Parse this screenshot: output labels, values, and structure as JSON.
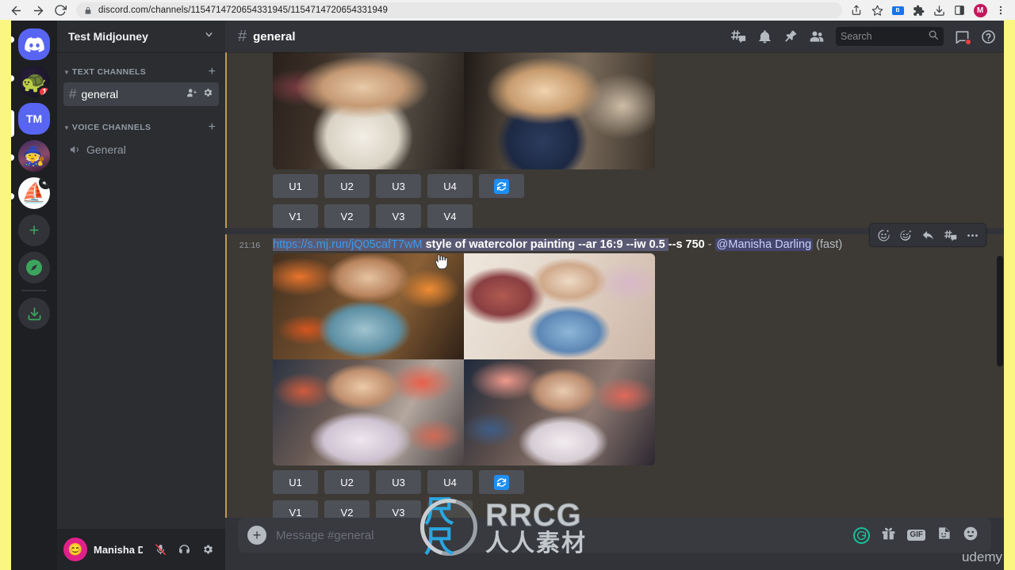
{
  "browser": {
    "url": "discord.com/channels/1154714720654331945/1154714720654331949",
    "back_label": "Back",
    "forward_label": "Forward",
    "reload_label": "Reload",
    "lock_icon": "lock-icon",
    "share_icon": "share-icon",
    "bookmark_icon": "star-icon",
    "extension_blue_label": "B",
    "puzzle_icon": "extensions-icon",
    "download_icon": "download-icon",
    "sidepanel_icon": "side-panel-icon",
    "profile_initial": "M",
    "menu_icon": "three-dot-menu-icon"
  },
  "server_rail": {
    "items": [
      {
        "name": "discord-home",
        "label": "",
        "type": "discord"
      },
      {
        "name": "server-turtle",
        "label": "",
        "type": "turtle",
        "badge": "1"
      },
      {
        "name": "server-test-midjouney",
        "label": "TM",
        "type": "tm",
        "active": true
      },
      {
        "name": "server-wizard",
        "label": "",
        "type": "wizard"
      },
      {
        "name": "server-sailboat",
        "label": "",
        "type": "boat",
        "muted": true
      }
    ],
    "add_server_label": "+",
    "explore_label": "explore-icon",
    "download_apps_label": "download-icon"
  },
  "sidebar": {
    "guild_name": "Test Midjouney",
    "guild_chevron": "chevron-down-icon",
    "categories": [
      {
        "label": "Text Channels",
        "add_label": "+",
        "channels": [
          {
            "name": "general",
            "hash": "#",
            "active": true,
            "icons": [
              "invite-icon",
              "settings-icon"
            ]
          }
        ]
      },
      {
        "label": "Voice Channels",
        "add_label": "+",
        "channels": [
          {
            "name": "General",
            "hash": "speaker-icon",
            "active": false,
            "icons": []
          }
        ]
      }
    ]
  },
  "user_panel": {
    "username": "Manisha D...",
    "mic_icon": "mic-muted-icon",
    "headset_icon": "headset-icon",
    "settings_icon": "gear-icon"
  },
  "chat_header": {
    "hash": "#",
    "channel": "general",
    "icons": [
      "threads-icon",
      "bell-icon",
      "pin-icon",
      "members-icon"
    ],
    "search_placeholder": "Search",
    "search_value": "",
    "inbox_icon": "inbox-icon",
    "help_icon": "help-icon"
  },
  "messages": {
    "top_message": {
      "buttons_row1": [
        "U1",
        "U2",
        "U3",
        "U4"
      ],
      "reroll_label": "reroll-icon",
      "buttons_row2": [
        "V1",
        "V2",
        "V3",
        "V4"
      ]
    },
    "selected_message": {
      "timestamp": "21:16",
      "link": "https://s.mj.run/jQ05cafT7wM",
      "prompt": "style of watercolor painting --ar 16:9 --iw 0.5",
      "params": "--s 750",
      "separator": "-",
      "mention": "@Manisha Darling",
      "mode": "(fast)",
      "buttons_row1": [
        "U1",
        "U2",
        "U3",
        "U4"
      ],
      "reroll_label": "reroll-icon",
      "buttons_row2": [
        "V1",
        "V2",
        "V3"
      ]
    },
    "hover_toolbar": {
      "items": [
        "add-reaction-icon",
        "super-reaction-icon",
        "reply-icon",
        "create-thread-icon",
        "more-options-icon"
      ]
    }
  },
  "composer": {
    "placeholder": "Message #general",
    "attach_label": "+",
    "icons": [
      "grammarly-icon",
      "gift-icon",
      "gif-icon",
      "sticker-icon",
      "emoji-icon"
    ],
    "gif_label": "GIF",
    "grammarly_label": "G"
  },
  "watermarks": {
    "rrcg": "RRCG",
    "rrcg_cn": "人人素材",
    "udemy": "udemy"
  },
  "colors": {
    "discord_blurple": "#5865f2",
    "chat_bg": "#313338",
    "sidebar_bg": "#2b2d31",
    "rail_bg": "#1e1f22",
    "mention_bar": "#c49a4a",
    "record_border": "#fbf582",
    "link": "#3c9aec",
    "badge_red": "#f23f43",
    "reroll_blue": "#1f8ef1"
  }
}
